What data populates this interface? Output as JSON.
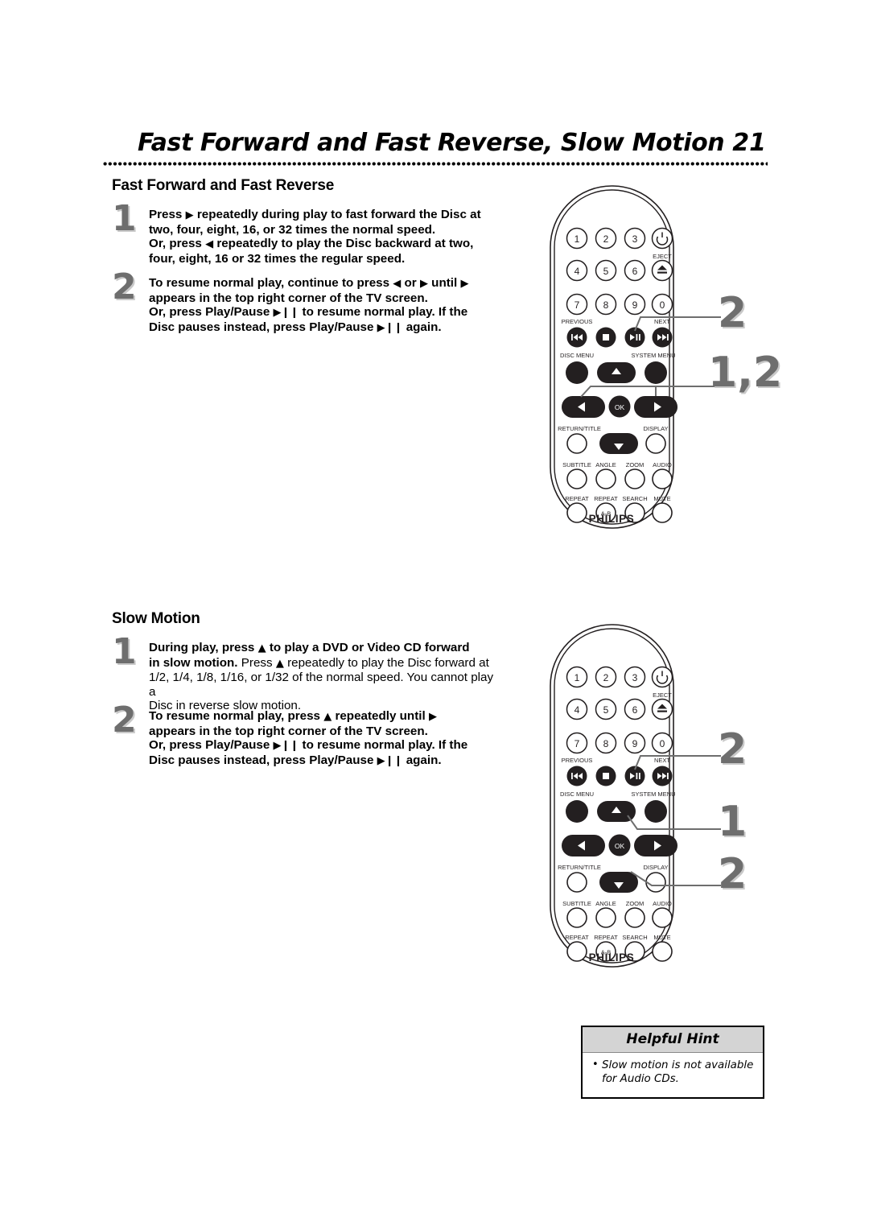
{
  "page": {
    "title": "Fast Forward and Fast Reverse, Slow Motion",
    "number": "21"
  },
  "sections": [
    {
      "heading": "Fast Forward and Fast Reverse",
      "steps": [
        {
          "number": "1",
          "line1_a": "Press",
          "line1_glyph": "▶",
          "line1_b": "repeatedly during play to fast forward the Disc at",
          "line2": "two, four, eight, 16, or 32 times the normal speed.",
          "line3_a": "Or, press",
          "line3_glyph": "◀",
          "line3_b": "repeatedly to play the Disc backward at two,",
          "line4": "four, eight, 16 or 32 times the regular speed."
        },
        {
          "number": "2",
          "line1_a": "To resume normal play, continue to press",
          "line1_glyph1": "◀",
          "line1_mid": "or",
          "line1_glyph2": "▶",
          "line1_b": "until",
          "line1_glyph3": "▶",
          "line2": "appears in the top right corner of the TV screen.",
          "line3_a": "Or, press Play/Pause",
          "line3_glyph": "▶❙❙",
          "line3_b": "to resume normal play. If the",
          "line4_a": "Disc pauses instead, press Play/Pause",
          "line4_glyph": "▶❙❙",
          "line4_b": "again."
        }
      ]
    },
    {
      "heading": "Slow Motion",
      "steps": [
        {
          "number": "1",
          "line1_a": "During play, press",
          "line1_glyph": "▲",
          "line1_b": "to play a DVD or Video CD forward",
          "line2_a": "in slow motion.",
          "line2_reg_a": "Press",
          "line2_glyph": "▲",
          "line2_reg_b": "repeatedly to play the Disc forward at",
          "line3": "1/2, 1/4, 1/8, 1/16, or 1/32 of the normal speed. You cannot play a",
          "line4": "Disc in reverse slow motion."
        },
        {
          "number": "2",
          "line1_a": "To resume normal play, press",
          "line1_glyph1": "▲",
          "line1_b": "repeatedly until",
          "line1_glyph2": "▶",
          "line2": "appears in the top right corner of the TV screen.",
          "line3_a": "Or, press Play/Pause",
          "line3_glyph": "▶❙❙",
          "line3_b": "to resume normal play. If the",
          "line4_a": "Disc pauses instead, press Play/Pause",
          "line4_glyph": "▶❙❙",
          "line4_b": "again."
        }
      ]
    }
  ],
  "remote": {
    "brand": "PHILIPS",
    "keypad": [
      "1",
      "2",
      "3",
      "4",
      "5",
      "6",
      "7",
      "8",
      "9",
      "0"
    ],
    "power_label": "",
    "eject_label": "EJECT",
    "transport_labels": {
      "previous": "PREVIOUS",
      "next": "NEXT"
    },
    "menu_labels": {
      "disc_menu": "DISC MENU",
      "system_menu": "SYSTEM MENU"
    },
    "ok_label": "OK",
    "nav_labels": {
      "return_title": "RETURN/TITLE",
      "display": "DISPLAY"
    },
    "feature_row_1": [
      "SUBTITLE",
      "ANGLE",
      "ZOOM",
      "AUDIO"
    ],
    "feature_row_2": [
      "REPEAT",
      "REPEAT",
      "SEARCH",
      "MUTE"
    ],
    "repeat_ab_label": "A-B"
  },
  "callouts": {
    "remote1": [
      "2",
      "1,2"
    ],
    "remote2": [
      "2",
      "1",
      "2"
    ]
  },
  "hint": {
    "title": "Helpful Hint",
    "bullet": "•",
    "items": [
      "Slow motion is not available for Audio CDs."
    ]
  },
  "colors": {
    "step_number": "#6e6e6e",
    "step_number_shadow": "#c9c9c9",
    "hint_header_bg": "#d4d4d4",
    "text": "#000000"
  }
}
